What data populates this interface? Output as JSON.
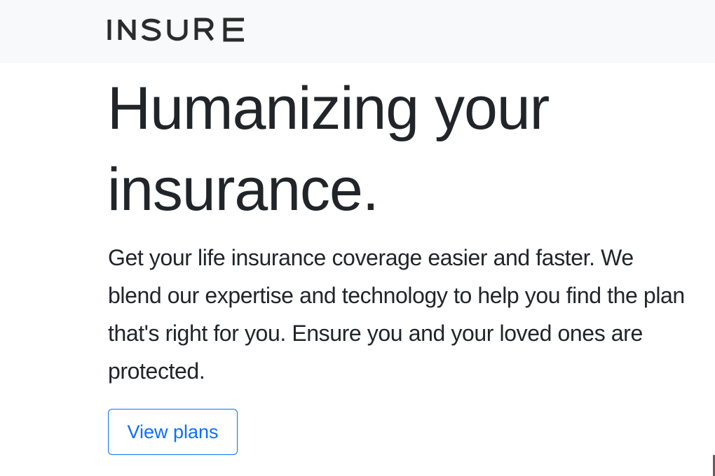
{
  "header": {
    "logo_text": "INSURE"
  },
  "hero": {
    "title": "Humanizing your insurance.",
    "description": "Get your life insurance coverage easier and faster. We blend our expertise and technology to help you find the plan that's right for you. Ensure you and your loved ones are protected.",
    "cta_label": "View plans"
  },
  "colors": {
    "navbar_bg": "#f8f9fa",
    "text": "#212529",
    "accent": "#0d6efd"
  }
}
